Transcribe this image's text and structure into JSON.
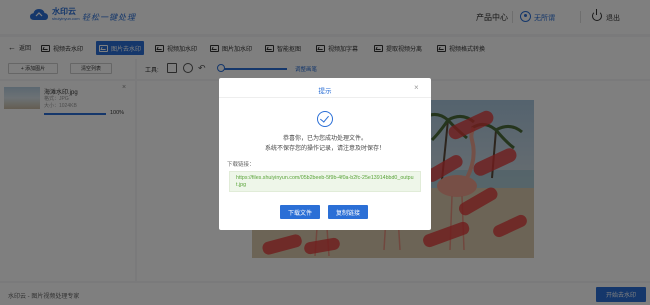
{
  "header": {
    "logo_name": "水印云",
    "logo_sub": "shuiyinyun.com",
    "slogan": "轻松一键处理",
    "product_center": "产品中心",
    "user_name": "无所谓",
    "logout": "退出"
  },
  "tabs": {
    "back": "返回",
    "items": [
      {
        "label": "视频去水印"
      },
      {
        "label": "图片去水印"
      },
      {
        "label": "视频加水印"
      },
      {
        "label": "图片加水印"
      },
      {
        "label": "智能抠图"
      },
      {
        "label": "视频加字幕"
      },
      {
        "label": "提取视频分离"
      },
      {
        "label": "视频格式转换"
      }
    ],
    "active_index": 1
  },
  "left_toolbar": {
    "add_image": "+ 添加图片",
    "clear_list": "清空列表"
  },
  "file": {
    "name": "海滩水印.jpg",
    "format": "格式：JPG",
    "size": "大小：1024KB",
    "progress_pct": 100,
    "progress_label": "100%"
  },
  "work_toolbar": {
    "tools_label": "工具:",
    "adjust_label": "调整画笔"
  },
  "footer": {
    "brand_text": "水印云 - 图片视频处理专家",
    "start_button": "开始去水印"
  },
  "modal": {
    "title": "提示",
    "line1": "恭喜你，已为您成功处理文件。",
    "line2": "系统不保存您的操作记录，请注意及时保存！",
    "download_label": "下载链接：",
    "download_url": "https://files.shuiyinyun.com/05b2beeb-5f9b-4f0a-b2fc-25e13914bbd0_output.jpg",
    "download_button": "下载文件",
    "copy_button": "复制链接"
  },
  "colors": {
    "accent": "#2b6fd6",
    "success_text": "#5aa43a",
    "brush": "#e03a3a"
  }
}
